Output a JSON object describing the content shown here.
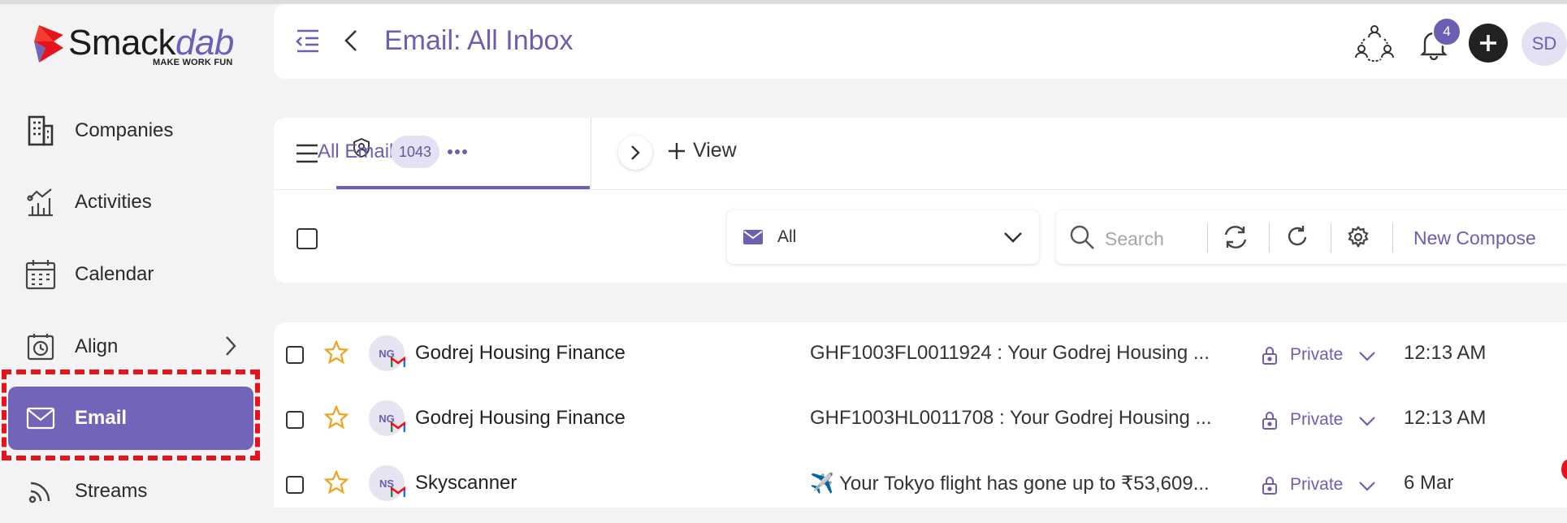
{
  "brand": {
    "name_main": "Smack",
    "name_accent": "dab",
    "tagline": "MAKE WORK FUN",
    "accent_color": "#6a5fb0",
    "logo_colors": [
      "#e5141c",
      "#7264b8"
    ]
  },
  "sidebar": {
    "items": [
      {
        "label": "Companies",
        "icon": "building-icon"
      },
      {
        "label": "Activities",
        "icon": "activities-chart-icon"
      },
      {
        "label": "Calendar",
        "icon": "calendar-icon"
      },
      {
        "label": "Align",
        "icon": "align-clock-icon",
        "has_chevron": true
      },
      {
        "label": "Email",
        "icon": "mail-icon",
        "active": true
      },
      {
        "label": "Streams",
        "icon": "streams-icon"
      }
    ]
  },
  "header": {
    "title": "Email: All Inbox",
    "notification_count": "4",
    "avatar_initials": "SD"
  },
  "tabs": {
    "active_label": "All Email",
    "active_count": "1043",
    "add_view_label": "View"
  },
  "toolbar": {
    "filter_value": "All",
    "search_placeholder": "Search",
    "compose_label": "New Compose"
  },
  "emails": [
    {
      "initials": "NG",
      "sender": "Godrej Housing Finance",
      "subject": "GHF1003FL0011924 : Your Godrej Housing ...",
      "visibility": "Private",
      "time": "12:13 AM"
    },
    {
      "initials": "NG",
      "sender": "Godrej Housing Finance",
      "subject": "GHF1003HL0011708 : Your Godrej Housing ...",
      "visibility": "Private",
      "time": "12:13 AM"
    },
    {
      "initials": "NS",
      "sender": "Skyscanner",
      "subject": "✈️ Your Tokyo flight has gone up to ₹53,609...",
      "visibility": "Private",
      "time": "6 Mar"
    }
  ]
}
